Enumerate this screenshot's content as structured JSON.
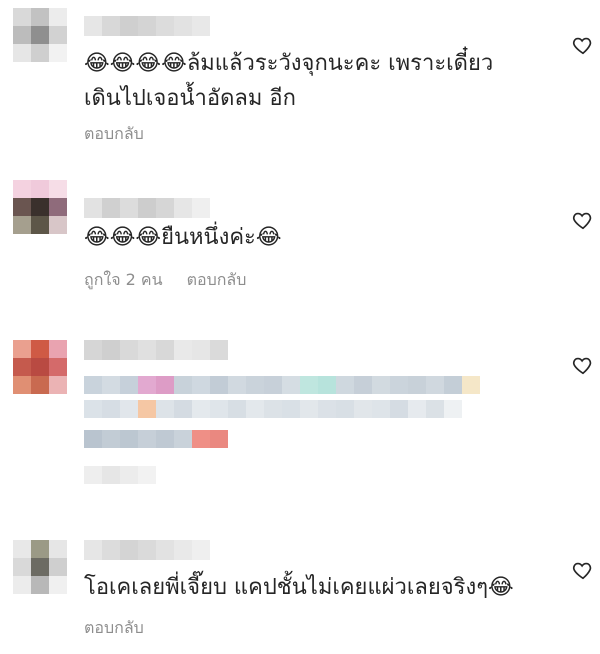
{
  "comments": [
    {
      "text": "😂😂😂😂ล้มแล้วระวังจุกนะคะ เพราะเดี๋ยว\nเดินไปเจอน้ำอัดลม อีก",
      "reply_label": "ตอบกลับ",
      "likes_label": ""
    },
    {
      "text": "😂😂😂ยืนหนึ่งค่ะ😂",
      "reply_label": "ตอบกลับ",
      "likes_label": "ถูกใจ 2 คน"
    },
    {
      "text": "",
      "reply_label": "",
      "likes_label": ""
    },
    {
      "text": "โอเคเลยพี่เจี๊ยบ แคปชั้นไม่เคยแผ่วเลยจริงๆ😂",
      "reply_label": "ตอบกลับ",
      "likes_label": ""
    }
  ],
  "icons": {
    "like": "heart-outline-icon"
  },
  "colors": {
    "text": "#262626",
    "meta": "#8e8e8e"
  }
}
